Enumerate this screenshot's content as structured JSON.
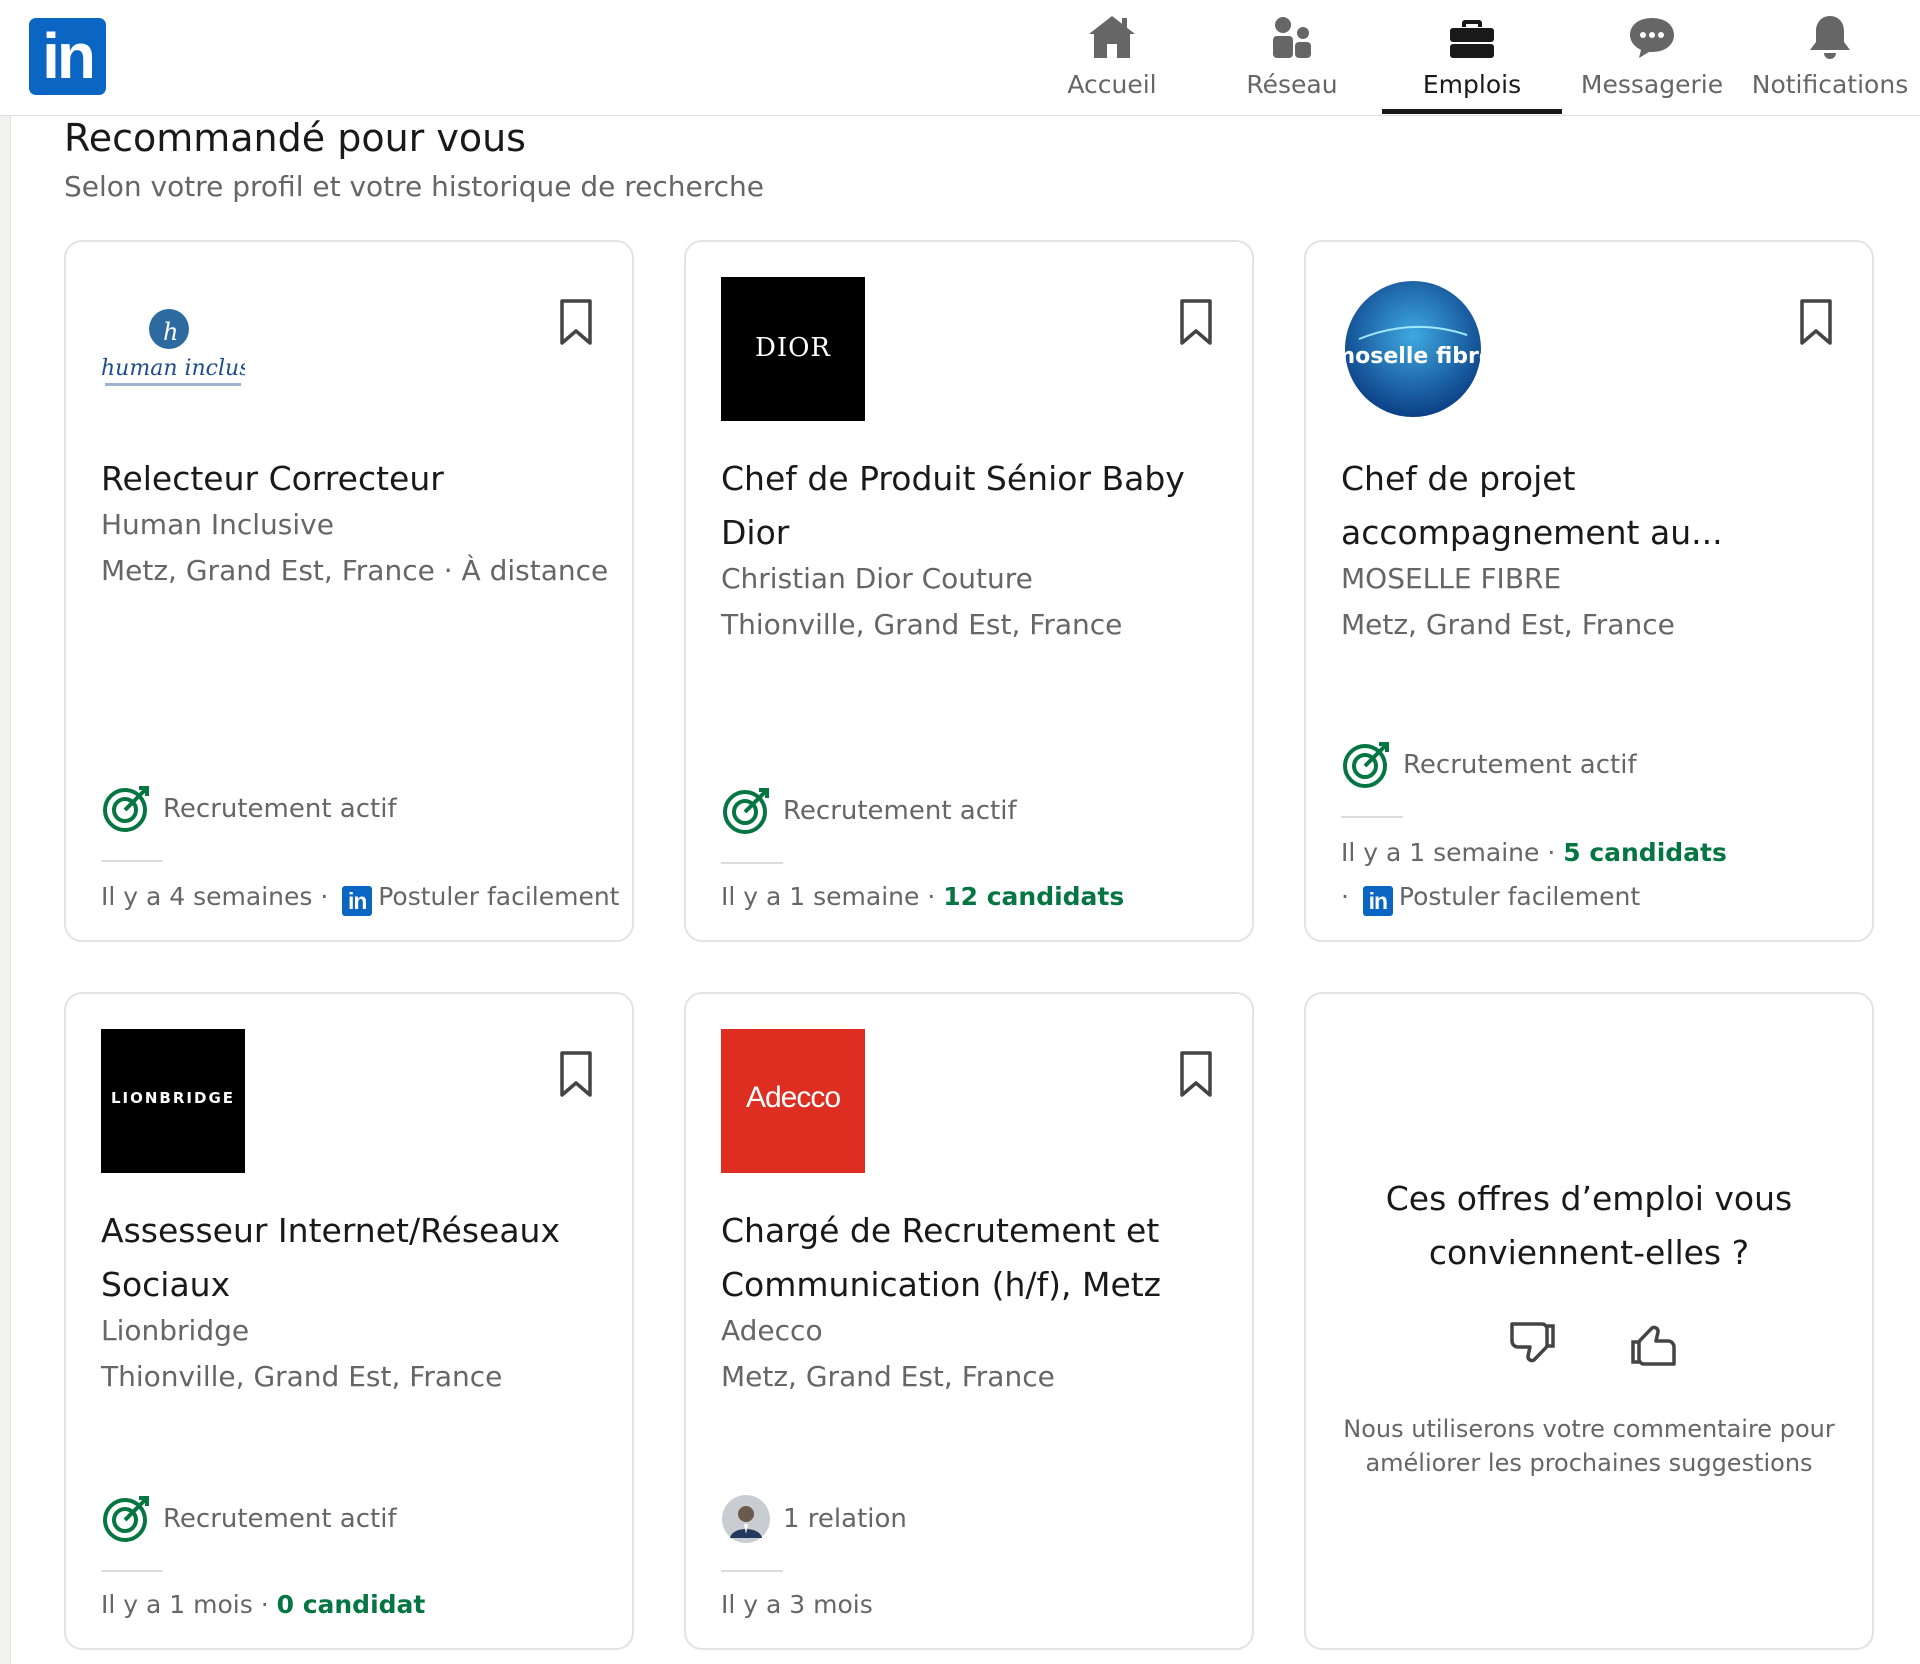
{
  "nav": {
    "items": [
      {
        "label": "Accueil",
        "icon": "home-icon"
      },
      {
        "label": "Réseau",
        "icon": "network-icon"
      },
      {
        "label": "Emplois",
        "icon": "jobs-icon",
        "active": true
      },
      {
        "label": "Messagerie",
        "icon": "messaging-icon"
      },
      {
        "label": "Notifications",
        "icon": "bell-icon"
      }
    ]
  },
  "brand": {
    "logo_text": "in",
    "color": "#0a66c2"
  },
  "section": {
    "title": "Recommandé pour vous",
    "subtitle": "Selon votre profil et votre historique de recherche"
  },
  "jobs": [
    {
      "title": "Relecteur Correcteur",
      "company": "Human Inclusive",
      "location": "Metz, Grand Est, France · À distance",
      "logo_text": "human inclusive",
      "insight": "Recrutement actif",
      "time": "Il y a 4 semaines · ",
      "easy_apply": "Postuler facilement"
    },
    {
      "title": "Chef de Produit Sénior Baby Dior",
      "company": "Christian Dior Couture",
      "location": "Thionville, Grand Est, France",
      "logo_text": "DIOR",
      "insight": "Recrutement actif",
      "time": "Il y a 1 semaine · ",
      "applicants": "12 candidats"
    },
    {
      "title": "Chef de projet accompagnement au...",
      "company": "MOSELLE FIBRE",
      "location": "Metz, Grand Est, France",
      "logo_text": "moselle fibre",
      "insight": "Recrutement actif",
      "time": "Il y a 1 semaine · ",
      "applicants": "5 candidats",
      "easy_apply_prefix": "· ",
      "easy_apply": "Postuler facilement"
    },
    {
      "title": "Assesseur Internet/Réseaux Sociaux",
      "company": "Lionbridge",
      "location": "Thionville, Grand Est, France",
      "logo_text": "LIONBRIDGE",
      "insight": "Recrutement actif",
      "time": "Il y a 1 mois · ",
      "applicants": "0 candidat"
    },
    {
      "title": "Chargé de Recrutement et Communication (h/f), Metz",
      "company": "Adecco",
      "location": "Metz, Grand Est, France",
      "logo_text": "Adecco",
      "insight": "1 relation",
      "time": "Il y a 3 mois"
    }
  ],
  "feedback": {
    "question": "Ces offres d’emploi vous conviennent-elles ?",
    "note": "Nous utiliserons votre commentaire pour améliorer les prochaines suggestions"
  },
  "colors": {
    "linkedin_blue": "#0a66c2",
    "green": "#057642",
    "dior_bg": "#000000",
    "lionbridge_bg": "#000000",
    "adecco_red": "#de2d21"
  }
}
